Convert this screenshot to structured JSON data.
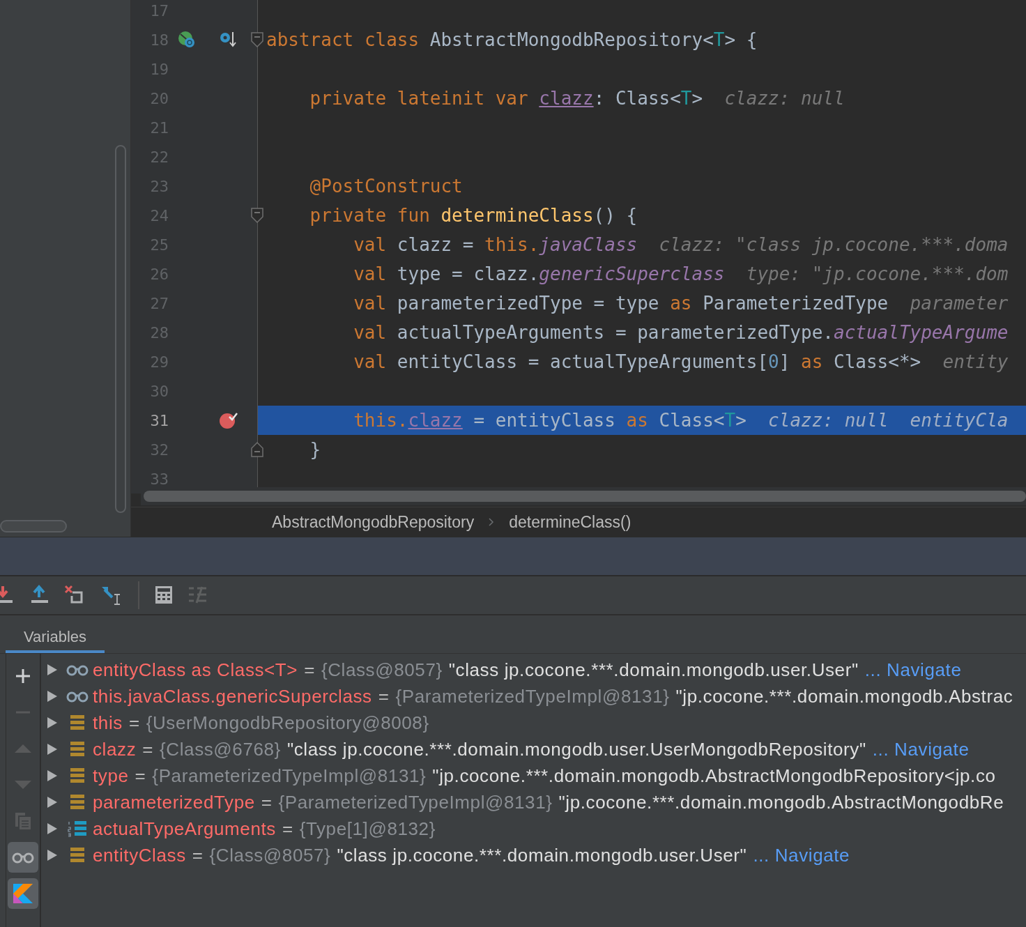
{
  "editor": {
    "lines": [
      {
        "number": "17",
        "current": false,
        "breakpoint": false
      },
      {
        "number": "18",
        "current": false,
        "breakpoint": false,
        "gutter": [
          {
            "kind": "subclassed"
          },
          {
            "kind": "overridden"
          }
        ],
        "fold": {
          "kind": "start"
        },
        "tokens": [
          {
            "kind": "keyword",
            "text": "abstract class "
          },
          {
            "kind": "plain",
            "text": "AbstractMongodbRepository<"
          },
          {
            "kind": "type_param",
            "text": "T"
          },
          {
            "kind": "plain",
            "text": "> {"
          }
        ],
        "children": [
          {
            "number": "19",
            "current": false,
            "breakpoint": false
          },
          {
            "number": "20",
            "current": false,
            "breakpoint": false,
            "tokens": [
              {
                "kind": "keyword",
                "text": "private lateinit var "
              },
              {
                "kind": "property",
                "text": "clazz"
              },
              {
                "kind": "plain",
                "text": ": Class<"
              },
              {
                "kind": "type_param",
                "text": "T"
              },
              {
                "kind": "plain",
                "text": ">"
              },
              {
                "kind": "hint",
                "text": "clazz: null"
              }
            ]
          },
          {
            "number": "21",
            "current": false,
            "breakpoint": false
          },
          {
            "number": "22",
            "current": false,
            "breakpoint": false
          },
          {
            "number": "23",
            "current": false,
            "breakpoint": false,
            "tokens": [
              {
                "kind": "annotation",
                "text": "@PostConstruct"
              }
            ]
          },
          {
            "number": "24",
            "current": false,
            "breakpoint": false,
            "fold": {
              "kind": "start"
            },
            "tokens": [
              {
                "kind": "keyword",
                "text": "private fun "
              },
              {
                "kind": "function",
                "text": "determineClass"
              },
              {
                "kind": "plain",
                "text": "() {"
              }
            ],
            "children": [
              {
                "number": "25",
                "current": false,
                "breakpoint": false,
                "tokens": [
                  {
                    "kind": "keyword",
                    "text": "val "
                  },
                  {
                    "kind": "plain",
                    "text": "clazz = "
                  },
                  {
                    "kind": "keyword",
                    "text": "this."
                  },
                  {
                    "kind": "field",
                    "text": "javaClass"
                  },
                  {
                    "kind": "hint",
                    "text": "clazz: \"class jp.cocone.***.doma"
                  }
                ]
              },
              {
                "number": "26",
                "current": false,
                "breakpoint": false,
                "tokens": [
                  {
                    "kind": "keyword",
                    "text": "val "
                  },
                  {
                    "kind": "plain",
                    "text": "type = clazz."
                  },
                  {
                    "kind": "field",
                    "text": "genericSuperclass"
                  },
                  {
                    "kind": "hint",
                    "text": "type: \"jp.cocone.***.dom"
                  }
                ]
              },
              {
                "number": "27",
                "current": false,
                "breakpoint": false,
                "tokens": [
                  {
                    "kind": "keyword",
                    "text": "val "
                  },
                  {
                    "kind": "plain",
                    "text": "parameterizedType = type "
                  },
                  {
                    "kind": "keyword",
                    "text": "as "
                  },
                  {
                    "kind": "plain",
                    "text": "ParameterizedType"
                  },
                  {
                    "kind": "hint",
                    "text": "parameter"
                  }
                ]
              },
              {
                "number": "28",
                "current": false,
                "breakpoint": false,
                "tokens": [
                  {
                    "kind": "keyword",
                    "text": "val "
                  },
                  {
                    "kind": "plain",
                    "text": "actualTypeArguments = parameterizedType."
                  },
                  {
                    "kind": "field",
                    "text": "actualTypeArgume"
                  }
                ]
              },
              {
                "number": "29",
                "current": false,
                "breakpoint": false,
                "tokens": [
                  {
                    "kind": "keyword",
                    "text": "val "
                  },
                  {
                    "kind": "plain",
                    "text": "entityClass = actualTypeArguments["
                  },
                  {
                    "kind": "number",
                    "text": "0"
                  },
                  {
                    "kind": "plain",
                    "text": "] "
                  },
                  {
                    "kind": "keyword",
                    "text": "as "
                  },
                  {
                    "kind": "plain",
                    "text": "Class<*>"
                  },
                  {
                    "kind": "hint",
                    "text": "entity"
                  }
                ]
              },
              {
                "number": "30",
                "current": false,
                "breakpoint": false
              },
              {
                "number": "31",
                "current": true,
                "breakpoint": true,
                "tokens": [
                  {
                    "kind": "keyword",
                    "text": "this."
                  },
                  {
                    "kind": "property",
                    "text": "clazz"
                  },
                  {
                    "kind": "plain",
                    "text": " = entityClass "
                  },
                  {
                    "kind": "keyword",
                    "text": "as "
                  },
                  {
                    "kind": "plain",
                    "text": "Class<"
                  },
                  {
                    "kind": "type_param",
                    "text": "T"
                  },
                  {
                    "kind": "plain",
                    "text": ">"
                  },
                  {
                    "kind": "hint",
                    "text": "clazz: null"
                  },
                  {
                    "kind": "hint",
                    "text": "entityCla"
                  }
                ]
              }
            ]
          },
          {
            "number": "32",
            "current": false,
            "breakpoint": false,
            "fold": {
              "kind": "end"
            },
            "tokens": [
              {
                "kind": "plain",
                "text": "}"
              }
            ]
          },
          {
            "number": "33",
            "current": false,
            "breakpoint": false
          }
        ]
      }
    ]
  },
  "breadcrumbs": [
    "AbstractMongodbRepository",
    "determineClass()"
  ],
  "debugger": {
    "tabs": [
      {
        "label": "Variables",
        "selected": true
      }
    ],
    "side_tools": [
      {
        "kind": "add",
        "disabled": false,
        "on": false
      },
      {
        "kind": "remove",
        "disabled": true,
        "on": false
      },
      {
        "kind": "up",
        "disabled": true,
        "on": false
      },
      {
        "kind": "down",
        "disabled": true,
        "on": false
      },
      {
        "kind": "copy",
        "disabled": true,
        "on": false
      },
      {
        "kind": "watches",
        "disabled": false,
        "on": true
      },
      {
        "kind": "kotlin",
        "disabled": false,
        "on": true
      }
    ],
    "variables": [
      {
        "kind": "watch",
        "expanded": false,
        "name": "entityClass as Class<T>",
        "operator": "=",
        "ref": "{Class@8057}",
        "value": "\"class jp.cocone.***.domain.mongodb.user.User\"",
        "link": "... Navigate"
      },
      {
        "kind": "watch",
        "expanded": false,
        "name": "this.javaClass.genericSuperclass",
        "operator": "=",
        "ref": "{ParameterizedTypeImpl@8131}",
        "value": "\"jp.cocone.***.domain.mongodb.Abstrac"
      },
      {
        "kind": "field",
        "expanded": false,
        "name": "this",
        "operator": "=",
        "ref": "{UserMongodbRepository@8008}"
      },
      {
        "kind": "field",
        "expanded": false,
        "name": "clazz",
        "operator": "=",
        "ref": "{Class@6768}",
        "value": "\"class jp.cocone.***.domain.mongodb.user.UserMongodbRepository\"",
        "link": "... Navigate"
      },
      {
        "kind": "field",
        "expanded": false,
        "name": "type",
        "operator": "=",
        "ref": "{ParameterizedTypeImpl@8131}",
        "value": "\"jp.cocone.***.domain.mongodb.AbstractMongodbRepository<jp.co"
      },
      {
        "kind": "field",
        "expanded": false,
        "name": "parameterizedType",
        "operator": "=",
        "ref": "{ParameterizedTypeImpl@8131}",
        "value": "\"jp.cocone.***.domain.mongodb.AbstractMongodbRe"
      },
      {
        "kind": "array",
        "expanded": false,
        "name": "actualTypeArguments",
        "operator": "=",
        "ref": "{Type[1]@8132}"
      },
      {
        "kind": "field",
        "expanded": false,
        "name": "entityClass",
        "operator": "=",
        "ref": "{Class@8057}",
        "value": "\"class jp.cocone.***.domain.mongodb.user.User\"",
        "link": "... Navigate"
      }
    ]
  }
}
